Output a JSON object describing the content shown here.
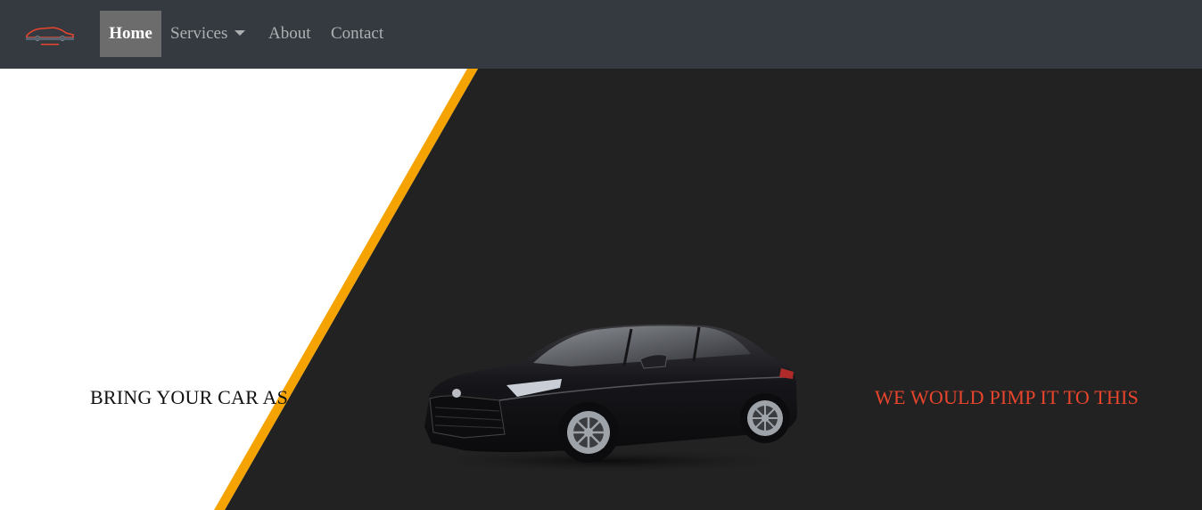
{
  "navbar": {
    "brand_icon": "car-logo-icon",
    "brand_color": "#e8452c",
    "items": [
      {
        "label": "Home",
        "active": true
      },
      {
        "label": "Services",
        "dropdown": true
      },
      {
        "label": "About"
      },
      {
        "label": "Contact"
      }
    ]
  },
  "hero": {
    "left_caption": "BRING YOUR CAR AS",
    "right_caption": "WE WOULD PIMP IT TO THIS",
    "image_icon": "black-sedan-car-image",
    "colors": {
      "dark_panel": "#222222",
      "accent_stripe": "#f5a300",
      "right_caption": "#e8452c"
    }
  }
}
